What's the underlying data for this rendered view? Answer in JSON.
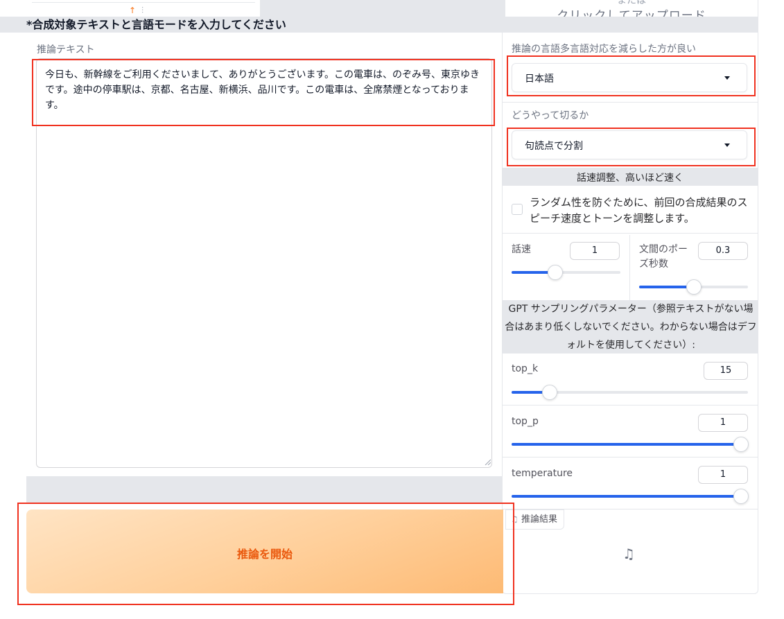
{
  "top": {
    "upload_or": "または",
    "upload_click": "クリックしてアップロード"
  },
  "section_title": "*合成対象テキストと言語モードを入力してください",
  "inference_text": {
    "label": "推論テキスト",
    "value": "今日も、新幹線をご利用くださいまして、ありがとうございます。この電車は、のぞみ号、東京ゆきです。途中の停車駅は、京都、名古屋、新横浜、品川です。この電車は、全席禁煙となっております。"
  },
  "language": {
    "label": "推論の言語多言語対応を減らした方が良い",
    "value": "日本語"
  },
  "split": {
    "label": "どうやって切るか",
    "value": "句読点で分割"
  },
  "speed_band": "話速調整、高いほど速く",
  "random_checkbox": {
    "label": "ランダム性を防ぐために、前回の合成結果のスピーチ速度とトーンを調整します。",
    "checked": false
  },
  "speed": {
    "label": "話速",
    "value": "1",
    "fraction": 0.4
  },
  "pause": {
    "label": "文間のポーズ秒数",
    "value": "0.3",
    "fraction": 0.5
  },
  "gpt_band": "GPT サンプリングパラメーター（参照テキストがない場合はあまり低くしないでください。わからない場合はデフォルトを使用してください）:",
  "top_k": {
    "label": "top_k",
    "value": "15",
    "fraction": 0.16
  },
  "top_p": {
    "label": "top_p",
    "value": "1",
    "fraction": 1.0
  },
  "temperature": {
    "label": "temperature",
    "value": "1",
    "fraction": 1.0
  },
  "result": {
    "label": "推論結果"
  },
  "start_button": {
    "label": "推論を開始"
  },
  "colors": {
    "accent": "#2563eb",
    "button_text": "#ea580c",
    "annotation": "#f0311f"
  }
}
